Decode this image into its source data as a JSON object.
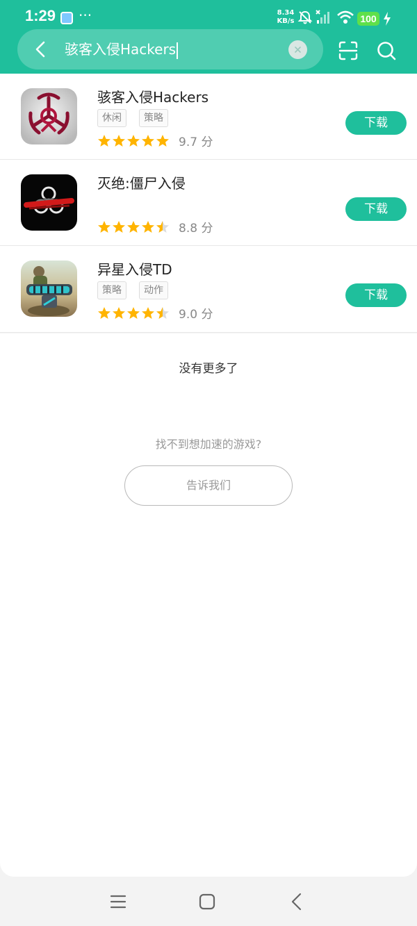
{
  "status_bar": {
    "time": "1:29",
    "more": "···",
    "net_speed_value": "8.34",
    "net_speed_unit": "KB/s",
    "battery": "100",
    "icons": [
      "app-notification-icon",
      "mute-icon",
      "signal-off-icon",
      "wifi-icon",
      "charging-icon"
    ]
  },
  "search": {
    "query": "骇客入侵Hackers"
  },
  "results": [
    {
      "name": "骇客入侵Hackers",
      "tags": [
        "休闲",
        "策略"
      ],
      "stars": 5,
      "score": "9.7 分",
      "button": "下载"
    },
    {
      "name": "灭绝:僵尸入侵",
      "tags": [],
      "stars": 4.5,
      "score": "8.8 分",
      "button": "下载"
    },
    {
      "name": "异星入侵TD",
      "tags": [
        "策略",
        "动作"
      ],
      "stars": 4.5,
      "score": "9.0 分",
      "button": "下载"
    }
  ],
  "footer": {
    "no_more": "没有更多了",
    "cant_find": "找不到想加速的游戏?",
    "tell_us": "告诉我们"
  },
  "colors": {
    "accent": "#1fbf9c",
    "star": "#ffb400"
  }
}
